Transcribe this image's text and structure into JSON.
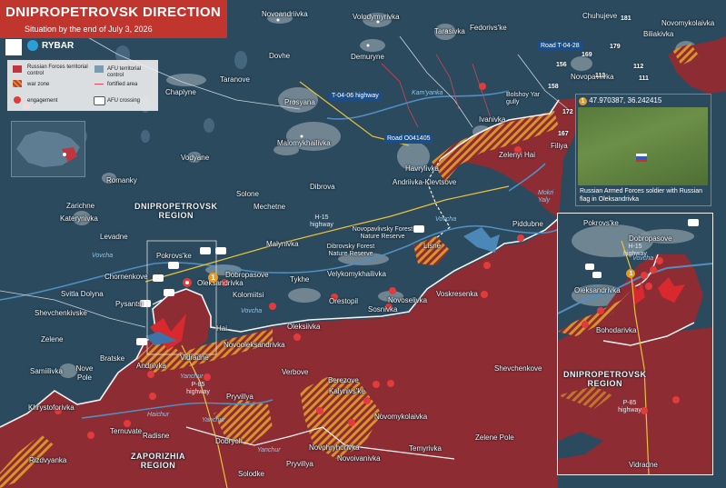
{
  "header": {
    "title": "DNIPROPETROVSK DIRECTION",
    "subtitle": "Situation by the end of July 3, 2026",
    "brand": "RYBAR"
  },
  "legend": {
    "items": [
      {
        "label": "Russian Forces territorial control",
        "swatch": "red-area"
      },
      {
        "label": "AFU territorial control",
        "swatch": "blue-area"
      },
      {
        "label": "war zone",
        "swatch": "hatched-area"
      },
      {
        "label": "fortified area",
        "swatch": "red-line"
      },
      {
        "label": "engagement",
        "swatch": "engagement-icon"
      },
      {
        "label": "AFU crossing",
        "swatch": "crossing-icon"
      }
    ]
  },
  "colors": {
    "russian_control": "#8e2c33",
    "afu_control": "#2b4a5e",
    "war_zone_hatch": "#d9922c",
    "front_line": "#f3f3f3",
    "header": "#c0352e",
    "road": "#1b4e86"
  },
  "towns": [
    {
      "name": "Novoandriivka"
    },
    {
      "name": "Volodymyrivka"
    },
    {
      "name": "Chuhujeve"
    },
    {
      "name": "Novomykolaivka"
    },
    {
      "name": "Biliakivka"
    },
    {
      "name": "Tarasivka"
    },
    {
      "name": "Fedorivs'ke"
    },
    {
      "name": "Dovhe"
    },
    {
      "name": "Demuryne"
    },
    {
      "name": "Taranove"
    },
    {
      "name": "Novopavlivka"
    },
    {
      "name": "Chaplyne"
    },
    {
      "name": "Prosyana"
    },
    {
      "name": "Ivanivka"
    },
    {
      "name": "Malomykhailivka"
    },
    {
      "name": "Vodyane"
    },
    {
      "name": "Havrylivka"
    },
    {
      "name": "Zelenyi Hai"
    },
    {
      "name": "Filiya"
    },
    {
      "name": "Romanky"
    },
    {
      "name": "Dibrova"
    },
    {
      "name": "Solone"
    },
    {
      "name": "Andriivka-Klevtsove"
    },
    {
      "name": "Zarichne"
    },
    {
      "name": "Mechetne"
    },
    {
      "name": "Katerynivka"
    },
    {
      "name": "Piddubne"
    },
    {
      "name": "Levadne"
    },
    {
      "name": "Malynivka"
    },
    {
      "name": "Lisne"
    },
    {
      "name": "Pokrovs'ke"
    },
    {
      "name": "Velykomykhailivka"
    },
    {
      "name": "Chornenkove"
    },
    {
      "name": "Dobropasove"
    },
    {
      "name": "Oleksandrivka"
    },
    {
      "name": "Tykhe"
    },
    {
      "name": "Orestopil"
    },
    {
      "name": "Voskresenka"
    },
    {
      "name": "Novoselivka"
    },
    {
      "name": "Kolomiitsi"
    },
    {
      "name": "Svitla Dolyna"
    },
    {
      "name": "Pysantsi"
    },
    {
      "name": "Sosnivka"
    },
    {
      "name": "Shevchenkivske"
    },
    {
      "name": "Hai"
    },
    {
      "name": "Oleksiivka"
    },
    {
      "name": "Zelene"
    },
    {
      "name": "Novooleksandrivka"
    },
    {
      "name": "Bratske"
    },
    {
      "name": "Vidradne"
    },
    {
      "name": "Samiilivka"
    },
    {
      "name": "Andriivka"
    },
    {
      "name": "Shevchenkove"
    },
    {
      "name": "Nove Pole"
    },
    {
      "name": "Verbove"
    },
    {
      "name": "Berezove"
    },
    {
      "name": "Kalynivs'ke"
    },
    {
      "name": "Pryvillya"
    },
    {
      "name": "Khrystoforivka"
    },
    {
      "name": "Novomykolaivka"
    },
    {
      "name": "Ternuvate"
    },
    {
      "name": "Radisne"
    },
    {
      "name": "Zelene Pole"
    },
    {
      "name": "Temyrivka"
    },
    {
      "name": "Novohryhorivka"
    },
    {
      "name": "Dobrych"
    },
    {
      "name": "Rizdvyanka"
    },
    {
      "name": "Novoivanivka"
    },
    {
      "name": "Solodke"
    },
    {
      "name": "Pryvillya"
    }
  ],
  "regions": [
    {
      "name": "DNIPROPETROVSK\nREGION"
    },
    {
      "name": "ZAPORIZHIA\nREGION"
    }
  ],
  "rivers": [
    "Kam'yanka",
    "Vovcha",
    "Vovcha",
    "Vovcha",
    "Mokri Yaly",
    "Yanchur",
    "Yanchur",
    "Haichur",
    "Yanchur"
  ],
  "roads": [
    {
      "name": "Road T-04-28"
    },
    {
      "name": "Road O041405"
    },
    {
      "name": "T-04-06 highway"
    },
    {
      "name": "H-15 highway"
    },
    {
      "name": "P-85 highway"
    }
  ],
  "features": [
    {
      "name": "Bolshoy Yar gully"
    },
    {
      "name": "Novopavlivsky Forest Nature Reserve"
    },
    {
      "name": "Dibrovsky Forest Nature Reserve"
    }
  ],
  "condition_numbers": [
    "181",
    "179",
    "169",
    "156",
    "113",
    "112",
    "111",
    "158",
    "172",
    "167"
  ],
  "photo": {
    "coordinates": "47.970387, 36.242415",
    "caption": "Russian Armed Forces soldier with Russian flag in Oleksandrivka",
    "marker": "1"
  },
  "inset": {
    "towns": [
      "Pokrovs'ke",
      "Dobropasove",
      "Oleksandrivka",
      "Bohodarivka",
      "Vidradne"
    ],
    "region": "DNIPROPETROVSK\nREGION",
    "roads": [
      "H-15 highway",
      "P-85 highway"
    ],
    "river": "Vovcha",
    "marker": "1"
  },
  "main_marker": "1"
}
